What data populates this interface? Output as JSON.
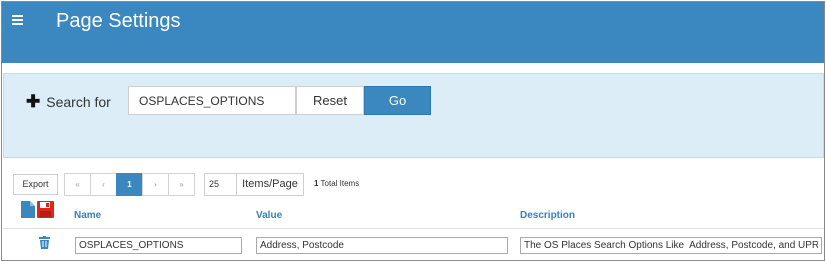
{
  "header": {
    "title": "Page Settings",
    "menu_icon": "hamburger-menu-icon"
  },
  "search": {
    "label": "Search for",
    "value": "OSPLACES_OPTIONS",
    "reset_label": "Reset",
    "go_label": "Go"
  },
  "toolbar": {
    "export_label": "Export",
    "pager": {
      "first": "«‹",
      "prev": "‹",
      "current": "1",
      "next": "›",
      "last": "›»"
    },
    "page_size": "25",
    "items_page_label": "Items/Page",
    "total_count": "1",
    "total_label": "Total Items"
  },
  "table": {
    "columns": {
      "name": "Name",
      "value": "Value",
      "description": "Description"
    },
    "rows": [
      {
        "name": "OSPLACES_OPTIONS",
        "value": "Address, Postcode",
        "description": "The OS Places Search Options Like  Address, Postcode, and UPRN"
      }
    ]
  },
  "colors": {
    "accent": "#3b87bf",
    "panel": "#dcedf8",
    "save_icon": "#e0241b",
    "file_icon": "#3b87bf"
  }
}
